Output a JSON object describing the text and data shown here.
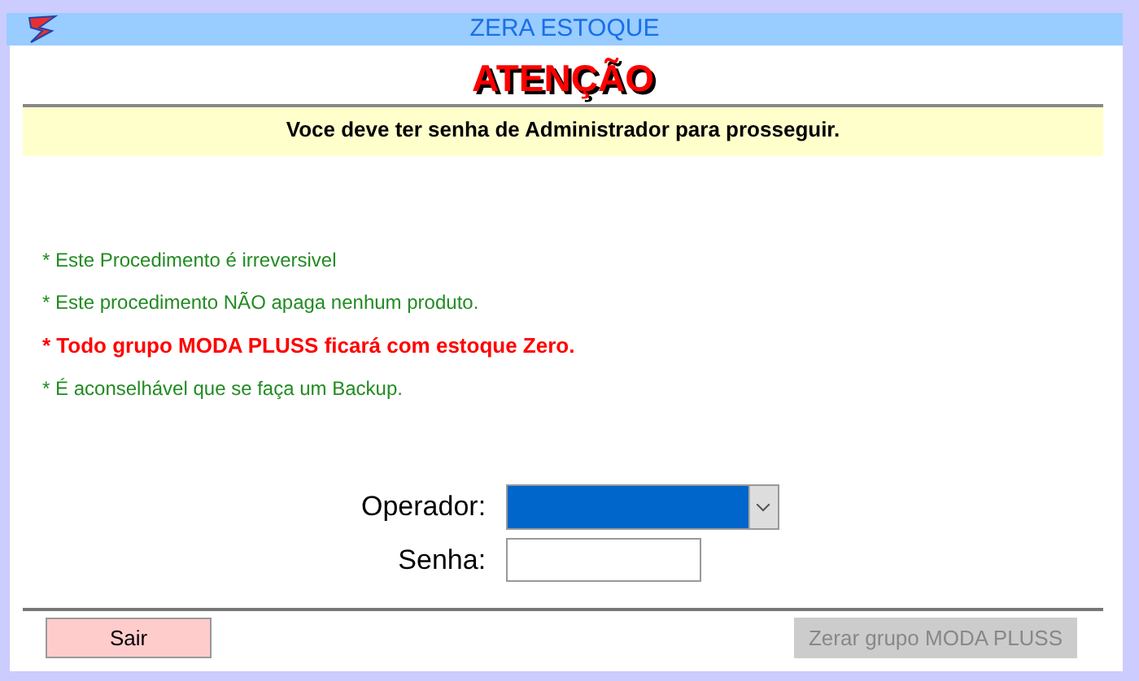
{
  "window": {
    "title": "ZERA ESTOQUE"
  },
  "heading": "ATENÇÃO",
  "notice": "Voce deve ter senha de Administrador para prosseguir.",
  "notes": [
    {
      "text": "* Este Procedimento é irreversivel",
      "kind": "info"
    },
    {
      "text": "* Este procedimento NÃO apaga nenhum produto.",
      "kind": "info"
    },
    {
      "text": "* Todo grupo MODA PLUSS ficará com estoque Zero.",
      "kind": "warning"
    },
    {
      "text": "* É aconselhável que se faça um Backup.",
      "kind": "info"
    }
  ],
  "form": {
    "operator_label": "Operador:",
    "operator_focused": true,
    "password_label": "Senha:"
  },
  "buttons": [
    {
      "label": "Sair",
      "disabled": false
    },
    {
      "label": "Zerar grupo MODA PLUSS",
      "disabled": true
    }
  ]
}
